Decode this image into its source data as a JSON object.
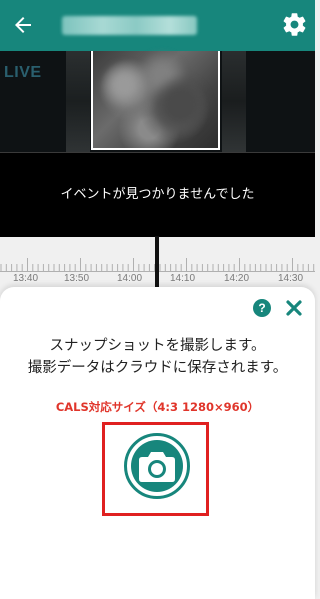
{
  "header": {
    "back_icon": "arrow-left-icon",
    "settings_icon": "gear-icon",
    "accent": "#17867c"
  },
  "video": {
    "live_label": "LIVE"
  },
  "events": {
    "empty_message": "イベントが見つかりませんでした"
  },
  "timeline": {
    "ticks": [
      "13:40",
      "13:50",
      "14:00",
      "14:10",
      "14:20",
      "14:30"
    ]
  },
  "snapshot_sheet": {
    "help_label": "?",
    "close_icon": "close-icon",
    "message_line1": "スナップショットを撮影します。",
    "message_line2": "撮影データはクラウドに保存されます。",
    "cals_note": "CALS対応サイズ（4:3 1280×960）",
    "capture_icon": "camera-icon",
    "highlight_color": "#e02020"
  }
}
